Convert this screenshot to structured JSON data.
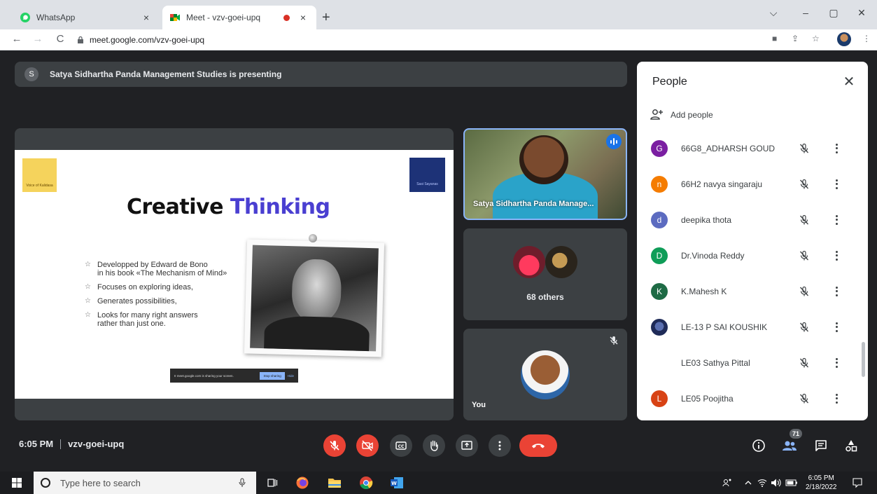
{
  "browser": {
    "tabs": [
      {
        "title": "WhatsApp",
        "close": "×"
      },
      {
        "title": "Meet - vzv-goei-upq",
        "close": "×"
      }
    ],
    "new_tab": "+",
    "window_controls": {
      "min": "–",
      "max": "▢",
      "close": "✕",
      "dropdown": "⌵"
    },
    "url": "meet.google.com/vzv-goei-upq",
    "nav": {
      "back": "←",
      "forward": "→",
      "reload": "C"
    },
    "toolbar_icons": {
      "camera": "■",
      "share": "⇪",
      "bookmark": "☆",
      "menu": "⋮"
    }
  },
  "presenting": {
    "avatar_letter": "S",
    "text": "Satya Sidhartha Panda Management Studies is presenting"
  },
  "slide": {
    "title_word1": "Creative",
    "title_word2": "Thinking",
    "logo_left_text": "Voice of Kalidasa",
    "logo_right_text": "Sasi Sayanas",
    "bullets": [
      "Developped by Edward de Bono\nin his book «The Mechanism of Mind»",
      "Focuses on exploring ideas,",
      "Generates possibilities,",
      "Looks for many right answers\nrather than just one."
    ],
    "bullet_glyph": "☆",
    "share_bar": {
      "text": "II  meet.google.com is sharing your screen.",
      "stop": "Stop sharing",
      "hide": "Hide"
    }
  },
  "tiles": {
    "speaker_name": "Satya Sidhartha Panda Manage...",
    "others_label": "68 others",
    "you_label": "You"
  },
  "people_panel": {
    "title": "People",
    "close": "✕",
    "add_label": "Add people",
    "participants": [
      {
        "initial": "G",
        "name": "66G8_ADHARSH GOUD",
        "color": "#7b1fa2"
      },
      {
        "initial": "n",
        "name": "66H2 navya singaraju",
        "color": "#f57c00"
      },
      {
        "initial": "d",
        "name": "deepika thota",
        "color": "#5c6bc0"
      },
      {
        "initial": "D",
        "name": "Dr.Vinoda Reddy",
        "color": "#0f9d58"
      },
      {
        "initial": "K",
        "name": "K.Mahesh K",
        "color": "#1e6b45"
      },
      {
        "initial": "",
        "name": "LE-13 P SAI KOUSHIK",
        "color": "image"
      },
      {
        "initial": "",
        "name": "LE03 Sathya Pittal",
        "color": "none"
      },
      {
        "initial": "L",
        "name": "LE05 Poojitha",
        "color": "#d84315"
      }
    ]
  },
  "controls": {
    "time": "6:05 PM",
    "meeting_code": "vzv-goei-upq",
    "participant_count": "71"
  },
  "taskbar": {
    "search_placeholder": "Type here to search",
    "time": "6:05 PM",
    "date": "2/18/2022"
  },
  "colors": {
    "meet_bg": "#202124",
    "tile_bg": "#3c4043",
    "accent_blue": "#8ab4f8",
    "end_red": "#ea4335",
    "title_purple": "#4a3fd1"
  }
}
